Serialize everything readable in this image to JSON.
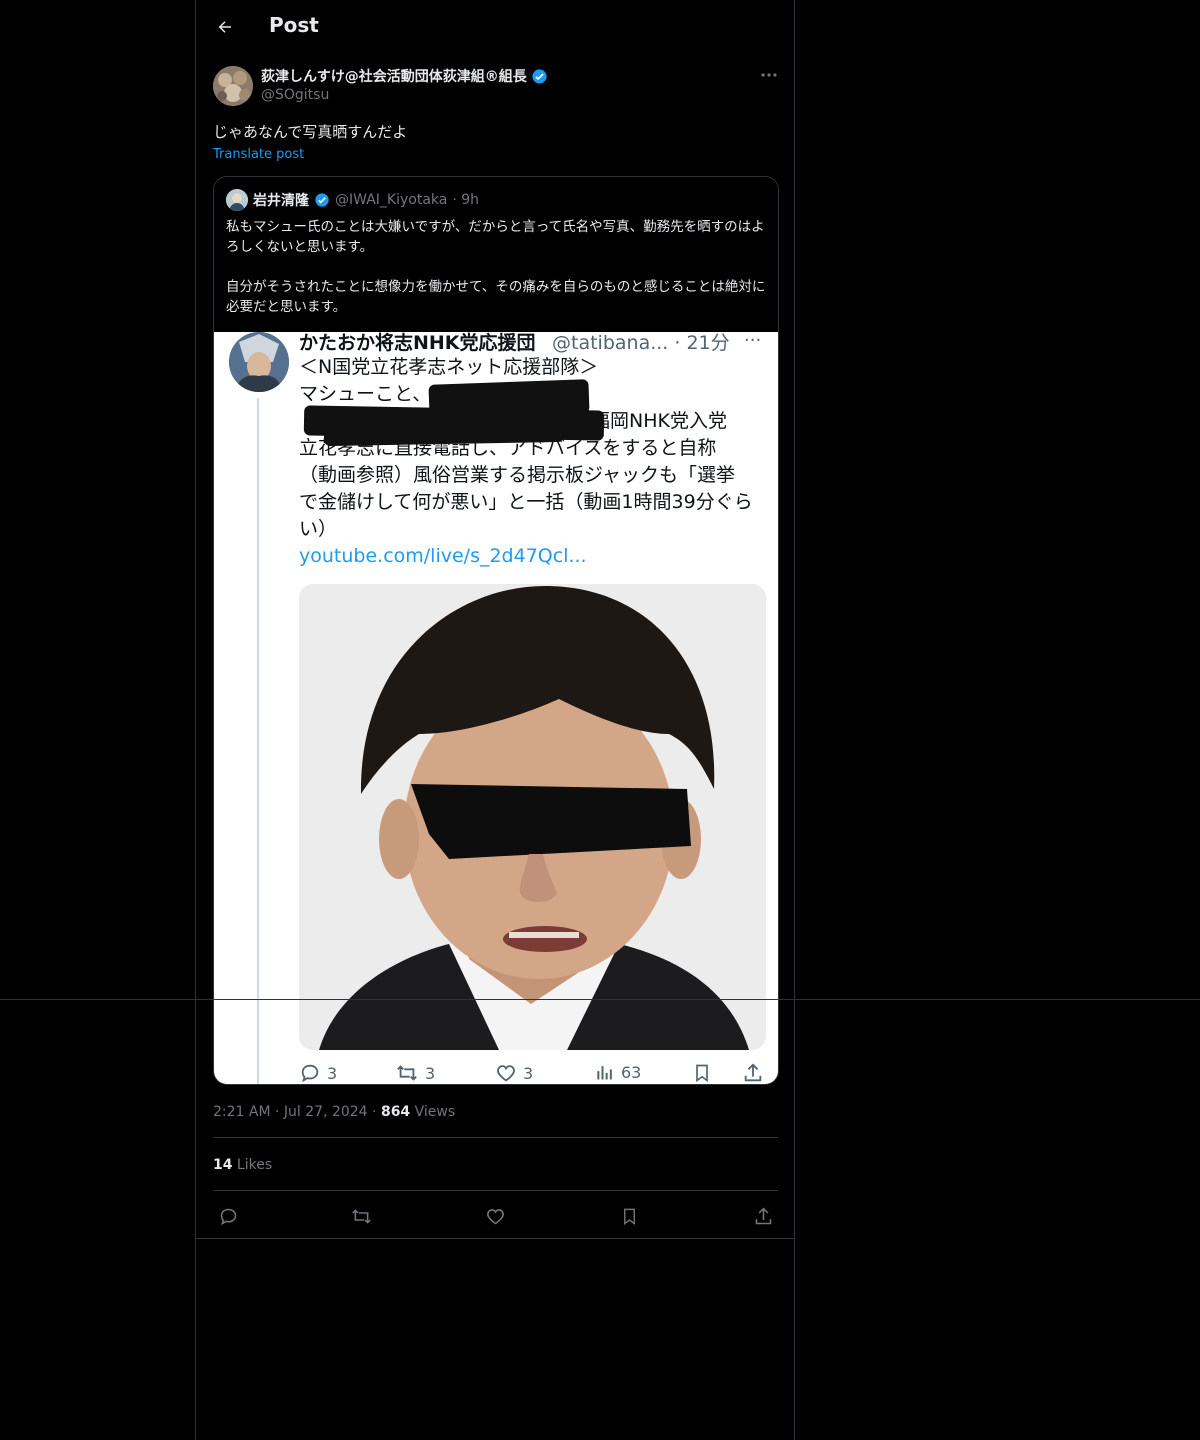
{
  "header": {
    "title": "Post"
  },
  "post": {
    "author_name": "荻津しんすけ@社会活動団体荻津組®組長",
    "author_handle": "@SOgitsu",
    "text": "じゃあなんで写真晒すんだよ",
    "translate_label": "Translate post",
    "time": "2:21 AM",
    "date": "Jul 27, 2024",
    "views_count": "864",
    "views_label": " Views",
    "likes_count": "14",
    "likes_label": " Likes",
    "verified": true
  },
  "quote": {
    "name": "岩井清隆",
    "handle": "@IWAI_Kiyotaka",
    "time": "· 9h",
    "paragraph1": "私もマシュー氏のことは大嫌いですが、だからと言って氏名や写真、勤務先を晒すのはよろしくないと思います。",
    "paragraph2": "自分がそうされたことに想像力を働かせて、その痛みを自らのものと感じることは絶対に必要だと思います。"
  },
  "screenshot": {
    "name": "かたおか将志NHK党応援団",
    "handle_time": "@tatibana... · 21分",
    "more": "···",
    "line1": "＜N国党立花孝志ネット応援部隊＞",
    "line2": "マシューこと、",
    "line3": "福岡NHK党入党",
    "line4": "立花孝志に直接電話し、アドバイスをすると自称",
    "line5": "（動画参照）風俗営業する掲示板ジャックも「選挙",
    "line6": "で金儲けして何が悪い」と一括（動画1時間39分ぐら",
    "line7": "い）",
    "link": "youtube.com/live/s_2d47Qcl...",
    "replies": "3",
    "reposts": "3",
    "likes": "3",
    "views": "63"
  },
  "icons": {
    "back": "arrow-left-icon",
    "more": "more-horizontal-icon",
    "verified": "verified-badge-icon",
    "reply": "reply-icon",
    "repost": "repost-icon",
    "like": "heart-icon",
    "bookmark": "bookmark-icon",
    "share": "share-icon"
  },
  "colors": {
    "background": "#000000",
    "text": "#e7e9ea",
    "muted": "#71767b",
    "accent": "#1d9bf0",
    "border": "#2f3336"
  }
}
